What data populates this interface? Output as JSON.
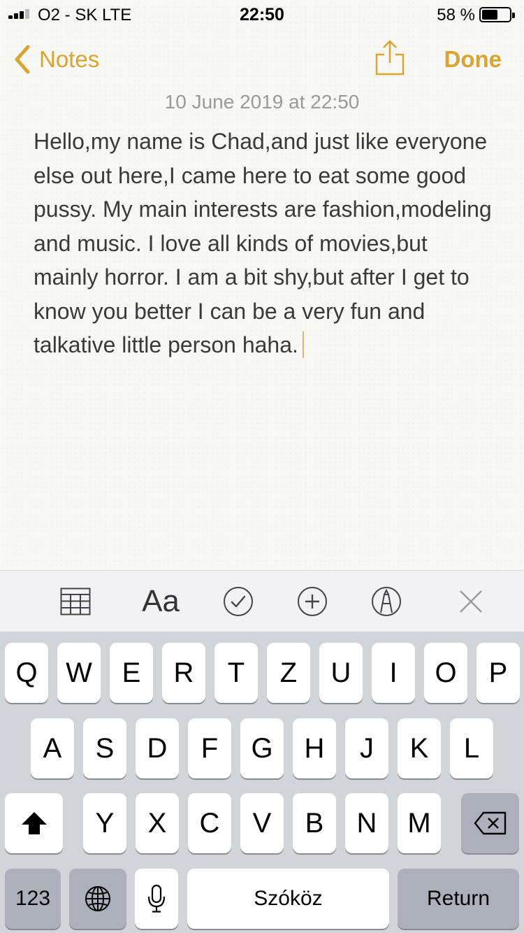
{
  "status_bar": {
    "carrier": "O2 - SK   LTE",
    "time": "22:50",
    "battery_percent": "58 %",
    "battery_level": 0.58
  },
  "nav": {
    "back_label": "Notes",
    "done_label": "Done",
    "accent_color": "#d9a52f"
  },
  "note": {
    "date": "10 June 2019 at 22:50",
    "text": "Hello,my name is Chad,and just like everyone else out here,I came here to eat some good pussy. My main interests are fashion,modeling and music. I love all kinds of movies,but mainly horror. I am a bit shy,but after I get to know you better I can be a very fun and talkative little person haha."
  },
  "toolbar": {
    "format_label": "Aa",
    "icons": [
      "table-icon",
      "text-format-icon",
      "checklist-icon",
      "add-icon",
      "markup-icon",
      "close-icon"
    ]
  },
  "keyboard": {
    "row1": [
      "Q",
      "W",
      "E",
      "R",
      "T",
      "Z",
      "U",
      "I",
      "O",
      "P"
    ],
    "row2": [
      "A",
      "S",
      "D",
      "F",
      "G",
      "H",
      "J",
      "K",
      "L"
    ],
    "row3": [
      "Y",
      "X",
      "C",
      "V",
      "B",
      "N",
      "M"
    ],
    "numbers_label": "123",
    "space_label": "Szóköz",
    "return_label": "Return"
  }
}
